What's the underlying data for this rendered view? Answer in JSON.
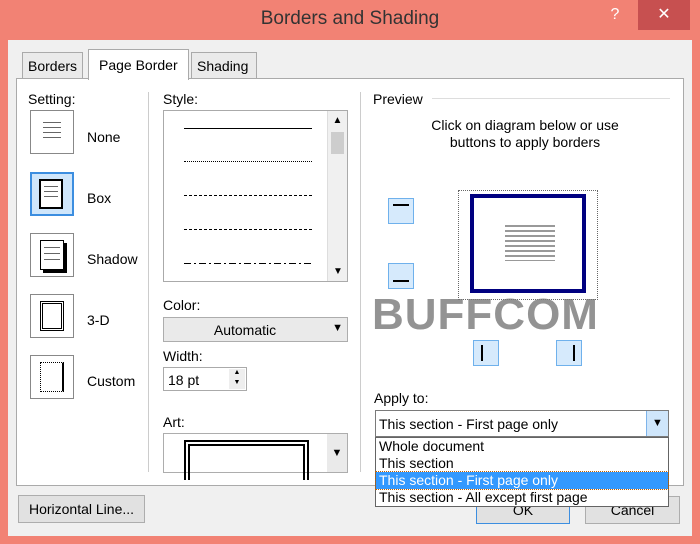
{
  "window": {
    "title": "Borders and Shading",
    "help": "?",
    "close": "✕"
  },
  "tabs": [
    {
      "label": "Borders"
    },
    {
      "label": "Page Border",
      "active": true
    },
    {
      "label": "Shading"
    }
  ],
  "setting": {
    "label": "Setting:",
    "items": [
      {
        "label": "None"
      },
      {
        "label": "Box",
        "selected": true
      },
      {
        "label": "Shadow"
      },
      {
        "label": "3-D"
      },
      {
        "label": "Custom"
      }
    ]
  },
  "style": {
    "label": "Style:",
    "options": [
      "solid",
      "dotted",
      "dashed-small",
      "dashed",
      "dash-dot"
    ]
  },
  "color": {
    "label": "Color:",
    "value": "Automatic"
  },
  "width": {
    "label": "Width:",
    "value": "18 pt"
  },
  "art": {
    "label": "Art:"
  },
  "preview": {
    "label": "Preview",
    "hint": "Click on diagram below or use buttons to apply borders",
    "border_color": "#000080"
  },
  "apply_to": {
    "label": "Apply to:",
    "value": "This section - First page only",
    "options": [
      "Whole document",
      "This section",
      "This section - First page only",
      "This section - All except first page"
    ],
    "highlighted": 2
  },
  "buttons": {
    "horizontal_line": "Horizontal Line...",
    "ok": "OK",
    "cancel": "Cancel"
  },
  "watermark": {
    "text": "BUFFCOM"
  },
  "colors": {
    "background": "#f28274",
    "selection": "#3399ff"
  }
}
